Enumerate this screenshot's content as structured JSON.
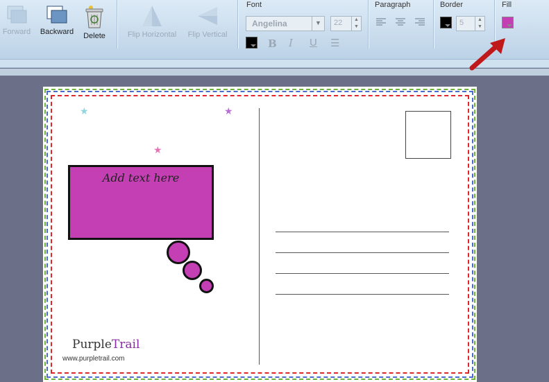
{
  "toolbar": {
    "forward_label": "Forward",
    "backward_label": "Backward",
    "delete_label": "Delete",
    "flip_horizontal_label": "Flip Horizontal",
    "flip_vertical_label": "Flip Vertical",
    "font_group_label": "Font",
    "font_name": "Angelina",
    "font_size": "22",
    "paragraph_group_label": "Paragraph",
    "border_group_label": "Border",
    "border_width": "5",
    "fill_group_label": "Fill",
    "bold_glyph": "B",
    "italic_glyph": "I",
    "underline_glyph": "U",
    "list_glyph": "☰",
    "colors": {
      "font_color": "#000000",
      "border_color": "#000000",
      "fill_color": "#c43fb4"
    }
  },
  "postcard": {
    "bubble_text": "Add text here",
    "logo_part1": "Purple",
    "logo_part2": "Trail",
    "website": "www.purpletrail.com"
  }
}
